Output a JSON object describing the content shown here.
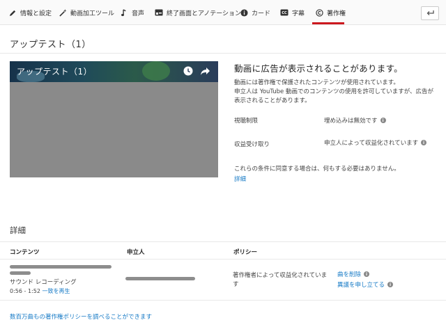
{
  "tabs": [
    {
      "label": "情報と設定",
      "icon": "pencil-icon"
    },
    {
      "label": "動画加工ツール",
      "icon": "magic-wand-icon"
    },
    {
      "label": "音声",
      "icon": "music-note-icon"
    },
    {
      "label": "終了画面とアノテーション",
      "icon": "end-screen-icon"
    },
    {
      "label": "カード",
      "icon": "info-icon"
    },
    {
      "label": "字幕",
      "icon": "captions-icon"
    },
    {
      "label": "著作権",
      "icon": "copyright-icon",
      "active": true
    }
  ],
  "page_title": "アップテスト（1）",
  "player": {
    "video_title": "アップテスト（1）"
  },
  "notice": {
    "title": "動画に広告が表示されることがあります。",
    "body_line1": "動画には著作権で保護されたコンテンツが使用されています。",
    "body_line2": "申立人は YouTube 動画でのコンテンツの使用を許可していますが、広告が表示されることがあります。",
    "viewing_label": "視聴制限",
    "viewing_value": "埋め込みは無効です",
    "revenue_label": "収益受け取り",
    "revenue_value": "申立人によって収益化されています",
    "agree_text": "これらの条件に同意する場合は、何もする必要はありません。",
    "details_link": "詳細"
  },
  "details": {
    "title": "詳細",
    "col_content": "コンテンツ",
    "col_claimant": "申立人",
    "col_policy": "ポリシー",
    "row": {
      "content_type": "サウンド レコーディング",
      "time_range": "0:56 - 1:52",
      "play_match": "一致を再生",
      "policy": "著作権者によって収益化されています",
      "remove_song": "曲を削除",
      "dispute": "異議を申し立てる"
    }
  },
  "footer_link": "数百万曲もの著作権ポリシーを調べることができます",
  "colors": {
    "accent_red": "#cc181e",
    "link_blue": "#167ac6"
  }
}
